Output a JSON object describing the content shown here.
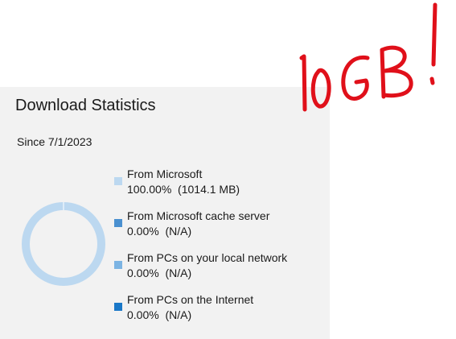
{
  "title": "Download Statistics",
  "since": "Since 7/1/2023",
  "annotation_text": "10 GB!",
  "legend": [
    {
      "label": "From Microsoft",
      "value": "100.00%  (1014.1 MB)",
      "color": "#bcd8f0",
      "fraction": 1.0
    },
    {
      "label": "From Microsoft cache server",
      "value": "0.00%  (N/A)",
      "color": "#4a90d0",
      "fraction": 0.0
    },
    {
      "label": "From PCs on your local network",
      "value": "0.00%  (N/A)",
      "color": "#7cb4e3",
      "fraction": 0.0
    },
    {
      "label": "From PCs on the Internet",
      "value": "0.00%  (N/A)",
      "color": "#1a78c8",
      "fraction": 0.0
    }
  ],
  "colors": {
    "panel_bg": "#f2f2f2",
    "annotation_red": "#e0101a"
  }
}
